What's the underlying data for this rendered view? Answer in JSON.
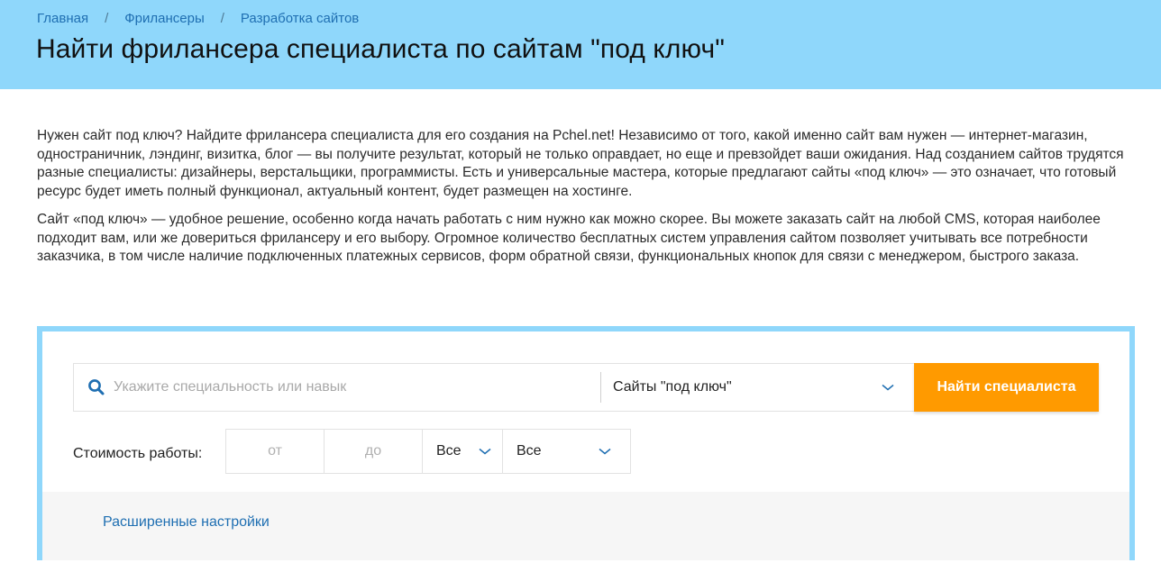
{
  "breadcrumb": {
    "items": [
      "Главная",
      "Фрилансеры",
      "Разработка сайтов"
    ],
    "separator": "/"
  },
  "page_title": "Найти фрилансера специалиста по сайтам \"под ключ\"",
  "description": {
    "paragraph_1": "Нужен сайт под ключ? Найдите фрилансера специалиста для его создания на Pchel.net! Независимо от того, какой именно сайт вам нужен — интернет-магазин, одностраничник, лэндинг, визитка, блог — вы получите результат, который не только оправдает, но еще и превзойдет ваши ожидания. Над созданием сайтов трудятся разные специалисты: дизайнеры, верстальщики, программисты. Есть и универсальные мастера, которые предлагают сайты «под ключ» — это означает, что готовый ресурс будет иметь полный функционал, актуальный контент, будет размещен на хостинге.",
    "paragraph_2": "Сайт «под ключ» — удобное решение, особенно когда начать работать с ним нужно как можно скорее. Вы можете заказать сайт на любой CMS, которая наиболее подходит вам, или же довериться фрилансеру и его выбору. Огромное количество бесплатных систем управления сайтом позволяет учитывать все потребности заказчика, в том числе наличие подключенных платежных сервисов, форм обратной связи, функциональных кнопок для связи с менеджером, быстрого заказа."
  },
  "search": {
    "placeholder": "Укажите специальность или навык",
    "value": "",
    "category_selected": "Сайты \"под ключ\"",
    "button_label": "Найти специалиста"
  },
  "cost": {
    "label": "Стоимость работы:",
    "from_placeholder": "от",
    "to_placeholder": "до",
    "currency_selected": "Все",
    "period_selected": "Все"
  },
  "advanced": {
    "link_label": "Расширенные настройки"
  },
  "colors": {
    "header_bg": "#8fd7fb",
    "link": "#1f6fb2",
    "accent_button": "#ff9a00",
    "panel_border": "#8fd7fb"
  },
  "icons": {
    "search": "search-icon",
    "dropdown": "chevron-down-icon"
  }
}
